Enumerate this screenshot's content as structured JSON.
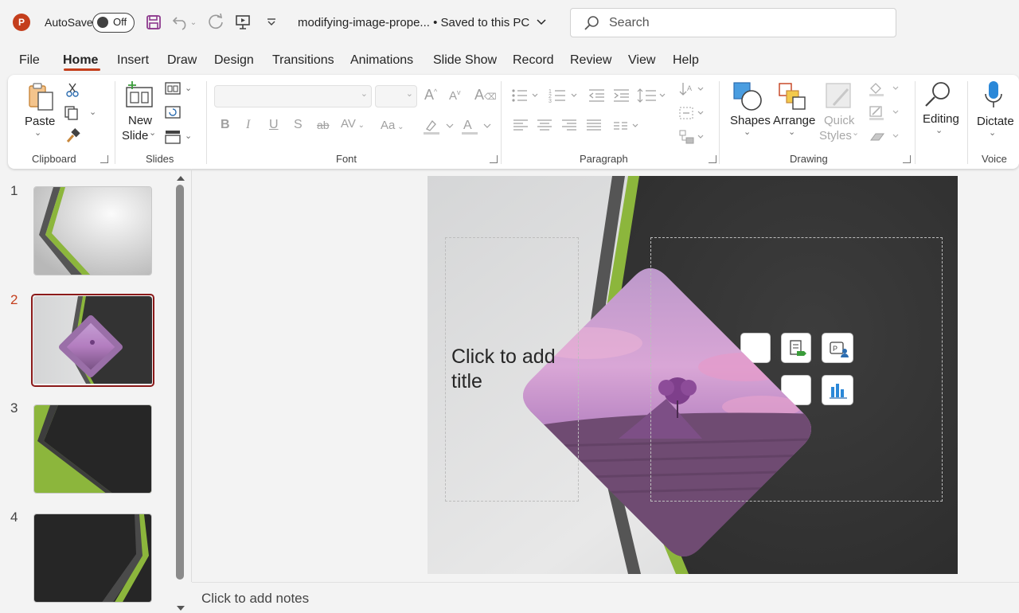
{
  "titlebar": {
    "autosave_label": "AutoSave",
    "autosave_state": "Off",
    "doc_title": "modifying-image-prope... • Saved to this PC",
    "search_placeholder": "Search"
  },
  "tabs": [
    "File",
    "Home",
    "Insert",
    "Draw",
    "Design",
    "Transitions",
    "Animations",
    "Slide Show",
    "Record",
    "Review",
    "View",
    "Help"
  ],
  "active_tab": "Home",
  "ribbon": {
    "clipboard": {
      "paste": "Paste",
      "group": "Clipboard"
    },
    "slides": {
      "new_slide_1": "New",
      "new_slide_2": "Slide",
      "group": "Slides"
    },
    "font": {
      "group": "Font"
    },
    "paragraph": {
      "group": "Paragraph"
    },
    "drawing": {
      "shapes": "Shapes",
      "arrange": "Arrange",
      "quick_styles_1": "Quick",
      "quick_styles_2": "Styles",
      "group": "Drawing"
    },
    "editing": {
      "label": "Editing"
    },
    "voice": {
      "dictate": "Dictate",
      "group": "Voice"
    }
  },
  "thumbnails": {
    "numbers": [
      "1",
      "2",
      "3",
      "4"
    ],
    "selected": "2"
  },
  "slide": {
    "title_placeholder": "Click to add title"
  },
  "notes": {
    "placeholder": "Click to add notes"
  },
  "colors": {
    "accent": "#c43e1c",
    "slide_green": "#8cb63c",
    "slide_dark": "#3a3a3a"
  }
}
